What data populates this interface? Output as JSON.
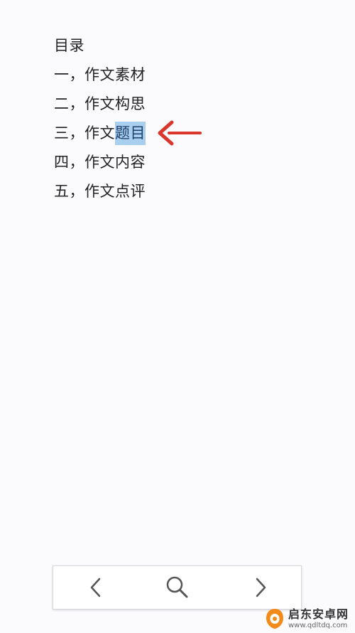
{
  "document": {
    "heading": "目录",
    "items": [
      "一，作文素材",
      "二，作文构思",
      {
        "prefix": "三，作文",
        "selected": "题目"
      },
      "四，作文内容",
      "五，作文点评"
    ]
  },
  "annotation": {
    "arrow_color": "#d9372b"
  },
  "toolbar": {
    "buttons": [
      "chevron-left-icon",
      "search-icon",
      "chevron-right-icon"
    ]
  },
  "watermark": {
    "brand": "启东安卓网",
    "url": "www.qdltdq.com"
  },
  "colors": {
    "selection": "#a9cfee",
    "text": "#222222",
    "background": "#fbfbfd"
  }
}
